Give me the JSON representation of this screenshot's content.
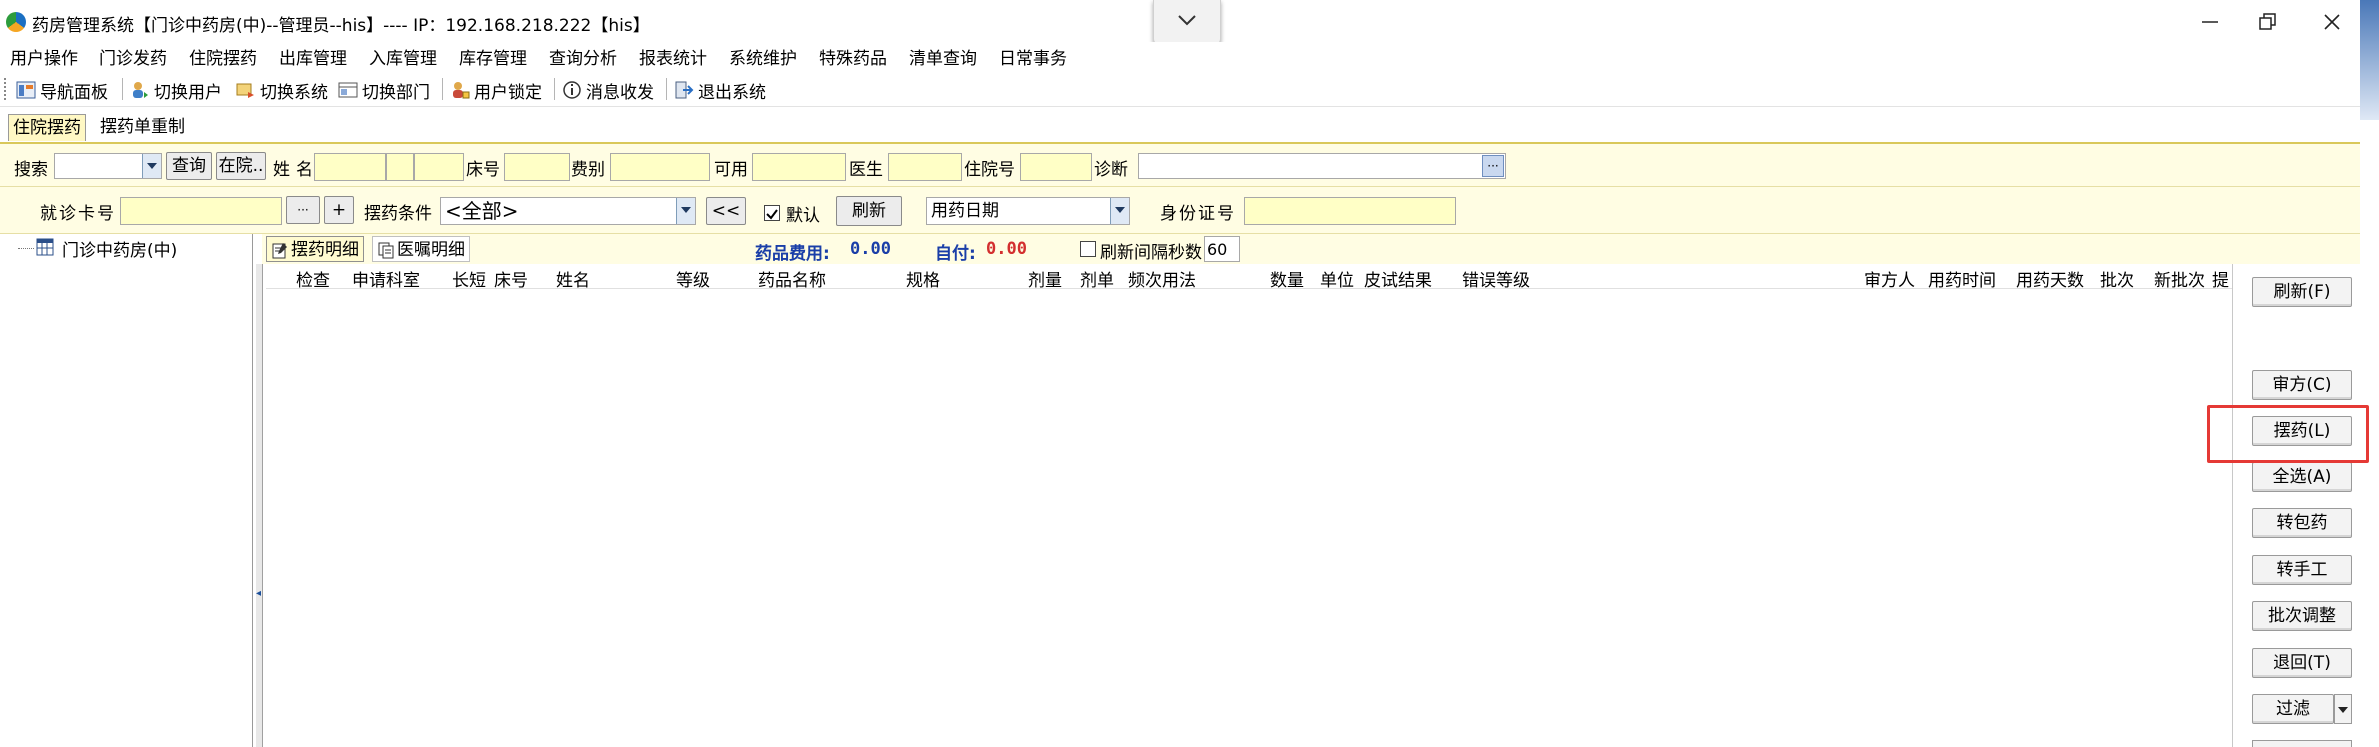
{
  "window": {
    "title": "药房管理系统【门诊中药房(中)--管理员--his】---- IP：192.168.218.222【his】"
  },
  "menu": [
    "用户操作",
    "门诊发药",
    "住院摆药",
    "出库管理",
    "入库管理",
    "库存管理",
    "查询分析",
    "报表统计",
    "系统维护",
    "特殊药品",
    "清单查询",
    "日常事务"
  ],
  "toolbar": [
    "导航面板",
    "切换用户",
    "切换系统",
    "切换部门",
    "用户锁定",
    "消息收发",
    "退出系统"
  ],
  "tabs": [
    "住院摆药",
    "摆药单重制"
  ],
  "row1": {
    "search_label": "搜索",
    "query_btn": "查询",
    "inhosp_btn": "在院..",
    "name_label": "姓名",
    "bed_label": "床号",
    "fee_label": "费别",
    "avail_label": "可用",
    "doctor_label": "医生",
    "inpatient_label": "住院号",
    "diag_label": "诊断",
    "more_btn": "···"
  },
  "row2": {
    "card_label": "就诊卡号",
    "ellipsis_btn": "···",
    "plus_btn": "+",
    "cond_label": "摆药条件",
    "cond_value": "<全部>",
    "back_btn": "<<",
    "default_label": "默认",
    "default_checked": true,
    "refresh_btn": "刷新",
    "date_select": "用药日期",
    "id_label": "身份证号"
  },
  "tree": {
    "root": "门诊中药房(中)"
  },
  "grid": {
    "tabs": [
      "摆药明细",
      "医嘱明细"
    ],
    "fee_label": "药品费用:",
    "fee_value": "0.00",
    "self_label": "自付:",
    "self_value": "0.00",
    "refresh_interval_label": "刷新间隔秒数",
    "refresh_interval_value": "60",
    "columns": [
      "检查",
      "申请科室",
      "长短",
      "床号",
      "姓名",
      "等级",
      "药品名称",
      "规格",
      "剂量",
      "剂单",
      "频次用法",
      "数量",
      "单位",
      "皮试结果",
      "错误等级",
      "审方人",
      "用药时间",
      "用药天数",
      "批次",
      "新批次",
      "提"
    ]
  },
  "side_buttons": [
    "刷新(F)",
    "审方(C)",
    "摆药(L)",
    "全选(A)",
    "转包药",
    "转手工",
    "批次调整",
    "退回(T)",
    "过滤"
  ],
  "colors": {
    "highlight": "#e53935",
    "form_bg": "#fffde3",
    "field_bg": "#ffffc6",
    "fee_value": "#1a3ea8",
    "self_value": "#d32f2f"
  }
}
